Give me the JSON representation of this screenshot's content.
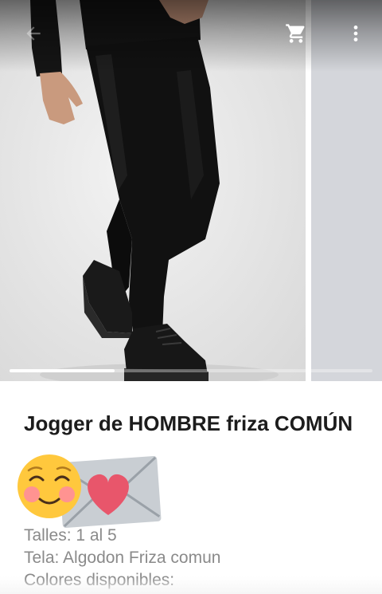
{
  "gallery": {
    "progress_fraction": 0.29
  },
  "toolbar": {
    "icons": [
      "back-arrow-icon",
      "cart-icon",
      "more-vert-icon"
    ]
  },
  "product": {
    "title": "Jogger de HOMBRE friza COMÚN",
    "lines": [
      "Talles: 1 al 5",
      "Tela: Algodon Friza comun",
      "Colores disponibles:"
    ]
  },
  "colors": {
    "text_primary": "#1c1c1c",
    "text_secondary": "#8a8a8a",
    "heart": "#e8566b",
    "emoji_face": "#ffc83d"
  }
}
